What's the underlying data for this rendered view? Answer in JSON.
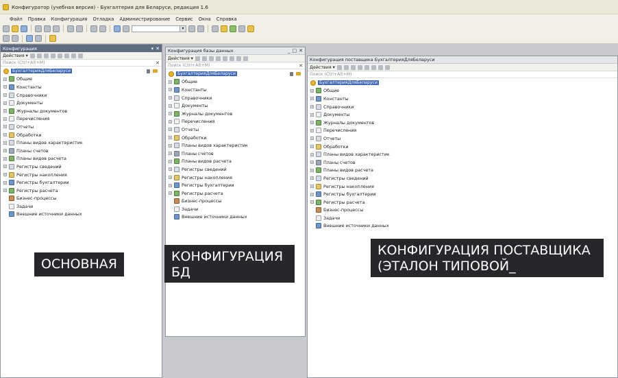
{
  "window": {
    "title": "Конфигуратор (учебная версия) - Бухгалтерия для Беларуси, редакция 1.6"
  },
  "menu": [
    "Файл",
    "Правка",
    "Конфигурация",
    "Отладка",
    "Администрирование",
    "Сервис",
    "Окна",
    "Справка"
  ],
  "panels": {
    "main": {
      "title": "Конфигурация",
      "actions_label": "Действия ▾",
      "search_placeholder": "Поиск (Ctrl+Alt+M)",
      "root": "БухгалтерияДляБеларуси",
      "items": [
        "Общие",
        "Константы",
        "Справочники",
        "Документы",
        "Журналы документов",
        "Перечисления",
        "Отчеты",
        "Обработки",
        "Планы видов характеристик",
        "Планы счетов",
        "Планы видов расчета",
        "Регистры сведений",
        "Регистры накопления",
        "Регистры бухгалтерии",
        "Регистры расчета",
        "Бизнес-процессы",
        "Задачи",
        "Внешние источники данных"
      ]
    },
    "db": {
      "title": "Конфигурация базы данных",
      "actions_label": "Действия ▾",
      "search_placeholder": "Поиск (Ctrl+Alt+M)",
      "root": "БухгалтерияДляБеларуси",
      "items": [
        "Общие",
        "Константы",
        "Справочники",
        "Документы",
        "Журналы документов",
        "Перечисления",
        "Отчеты",
        "Обработки",
        "Планы видов характеристик",
        "Планы счетов",
        "Планы видов расчета",
        "Регистры сведений",
        "Регистры накопления",
        "Регистры бухгалтерии",
        "Регистры расчета",
        "Бизнес-процессы",
        "Задачи",
        "Внешние источники данных"
      ]
    },
    "vendor": {
      "title": "Конфигурация поставщика БухгалтерияДляБеларуси",
      "actions_label": "Действия ▾",
      "search_placeholder": "Поиск (Ctrl+Alt+M)",
      "root": "БухгалтерияДляБеларуси",
      "items": [
        "Общие",
        "Константы",
        "Справочники",
        "Документы",
        "Журналы документов",
        "Перечисления",
        "Отчеты",
        "Обработки",
        "Планы видов характеристик",
        "Планы счетов",
        "Планы видов расчета",
        "Регистры сведений",
        "Регистры накопления",
        "Регистры бухгалтерии",
        "Регистры расчета",
        "Бизнес-процессы",
        "Задачи",
        "Внешние источники данных"
      ]
    }
  },
  "captions": {
    "main": "ОСНОВНАЯ",
    "db_line1": "КОНФИГУРАЦИЯ",
    "db_line2": "БД",
    "vendor_line1": "КОНФИГУРАЦИЯ ПОСТАВЩИКА",
    "vendor_line2": "(ЭТАЛОН ТИПОВОЙ_"
  }
}
